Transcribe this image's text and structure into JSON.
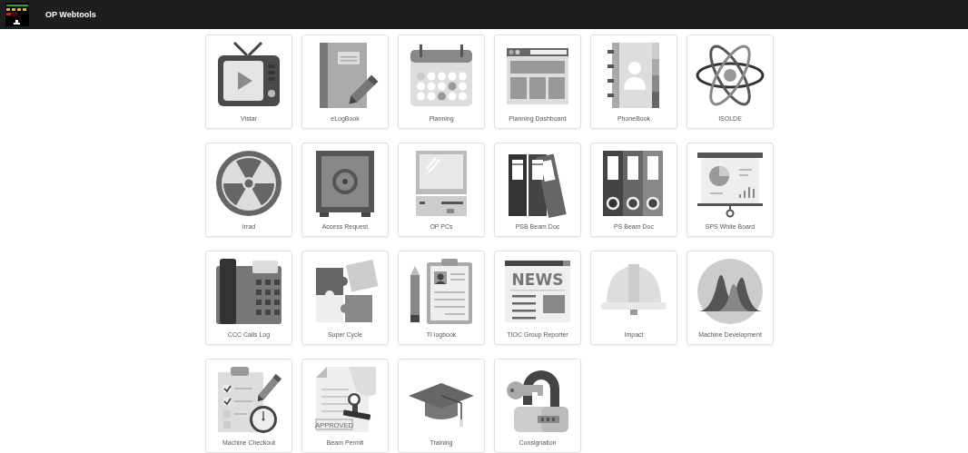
{
  "header": {
    "title": "OP Webtools"
  },
  "tiles": [
    {
      "label": "Vistar",
      "kind": "tv"
    },
    {
      "label": "eLogBook",
      "kind": "notebook"
    },
    {
      "label": "Planning",
      "kind": "calendar"
    },
    {
      "label": "Planning Dashboard",
      "kind": "dashboard"
    },
    {
      "label": "PhoneBook",
      "kind": "phonebook"
    },
    {
      "label": "ISOLDE",
      "kind": "atom"
    },
    {
      "label": "Irrad",
      "kind": "radiation"
    },
    {
      "label": "Access Request",
      "kind": "safe"
    },
    {
      "label": "OP PCs",
      "kind": "computer"
    },
    {
      "label": "PSB Beam Doc",
      "kind": "binders-tilted"
    },
    {
      "label": "PS Beam Doc",
      "kind": "binders"
    },
    {
      "label": "SPS White Board",
      "kind": "whiteboard"
    },
    {
      "label": "CCC Calls Log",
      "kind": "phone"
    },
    {
      "label": "Super Cycle",
      "kind": "puzzle"
    },
    {
      "label": "TI logbook",
      "kind": "clipboard"
    },
    {
      "label": "TIOC Group Reporter",
      "kind": "news",
      "icon_text": "NEWS"
    },
    {
      "label": "Impact",
      "kind": "helmet"
    },
    {
      "label": "Machine Development",
      "kind": "peaks"
    },
    {
      "label": "Machine Checkout",
      "kind": "checklist"
    },
    {
      "label": "Beam Permit",
      "kind": "stamp",
      "icon_text": "APPROVED"
    },
    {
      "label": "Training",
      "kind": "cap"
    },
    {
      "label": "Consignation",
      "kind": "padlock"
    }
  ]
}
